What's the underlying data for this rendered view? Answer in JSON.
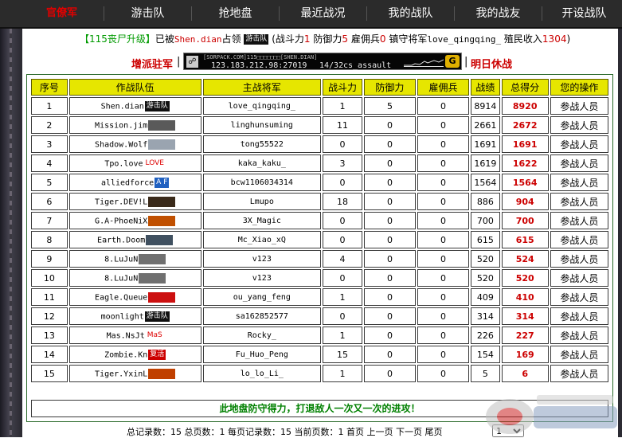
{
  "nav": {
    "items": [
      {
        "label": "官僚军",
        "active": true
      },
      {
        "label": "游击队"
      },
      {
        "label": "抢地盘"
      },
      {
        "label": "最近战况"
      },
      {
        "label": "我的战队"
      },
      {
        "label": "我的战友"
      },
      {
        "label": "开设战队"
      }
    ]
  },
  "info": {
    "level_tag": "【115丧尸升级】",
    "was_by": "已被",
    "occupier": "Shen.dian",
    "occupied": "占领",
    "team_badge": "游击队",
    "combat_label": "(战斗力",
    "combat_value": "1",
    "defense_label": "防御力",
    "defense_value": "5",
    "merc_label": "雇佣兵",
    "merc_value": "0",
    "general_label": "镇守将军",
    "general_value": "love_qingqing_",
    "income_label": "殖民收入",
    "income_value": "1304",
    "close": ")"
  },
  "station": {
    "deploy": "增派驻军",
    "sep": "|",
    "tomorrow": "明日休战",
    "banner_line1": "[SORPACK.COM]115□□□□□□□[SHEN.DIAN]",
    "banner_ip": "123.183.212.98:27019",
    "banner_players": "14/32",
    "banner_map": "cs_assault",
    "banner_logo": "G"
  },
  "table": {
    "headers": [
      "序号",
      "作战队伍",
      "主战将军",
      "战斗力",
      "防御力",
      "雇佣兵",
      "战绩",
      "总得分",
      "您的操作"
    ],
    "rows": [
      {
        "no": "1",
        "team": "Shen.dian",
        "icon": "游击队",
        "icon_color": "#111111",
        "general": "love_qingqing_",
        "combat": "1",
        "defense": "5",
        "merc": "0",
        "record": "8914",
        "score": "8920",
        "action": "参战人员"
      },
      {
        "no": "2",
        "team": "Mission.jim",
        "icon": "",
        "icon_color": "#5a5a5a",
        "general": "linghunsuming",
        "combat": "11",
        "defense": "0",
        "merc": "0",
        "record": "2661",
        "score": "2672",
        "action": "参战人员"
      },
      {
        "no": "3",
        "team": "Shadow.Wolf",
        "icon": "",
        "icon_color": "#9aa4b0",
        "general": "tong55522",
        "combat": "0",
        "defense": "0",
        "merc": "0",
        "record": "1691",
        "score": "1691",
        "action": "参战人员"
      },
      {
        "no": "4",
        "team": "Tpo.love",
        "icon": "LOVE",
        "icon_color": "#ffffff",
        "general": "kaka_kaku_",
        "combat": "3",
        "defense": "0",
        "merc": "0",
        "record": "1619",
        "score": "1622",
        "action": "参战人员"
      },
      {
        "no": "5",
        "team": "alliedforce",
        "icon": "A F",
        "icon_color": "#2060c0",
        "general": "bcw1106034314",
        "combat": "0",
        "defense": "0",
        "merc": "0",
        "record": "1564",
        "score": "1564",
        "action": "参战人员"
      },
      {
        "no": "6",
        "team": "Tiger.DEV!L",
        "icon": "",
        "icon_color": "#3a2a1a",
        "general": "Lmupo",
        "combat": "18",
        "defense": "0",
        "merc": "0",
        "record": "886",
        "score": "904",
        "action": "参战人员"
      },
      {
        "no": "7",
        "team": "G.A-PhoeNiX",
        "icon": "",
        "icon_color": "#c05000",
        "general": "3X_Magic",
        "combat": "0",
        "defense": "0",
        "merc": "0",
        "record": "700",
        "score": "700",
        "action": "参战人员"
      },
      {
        "no": "8",
        "team": "Earth.Doom",
        "icon": "",
        "icon_color": "#405060",
        "general": "Mc_Xiao_xQ",
        "combat": "0",
        "defense": "0",
        "merc": "0",
        "record": "615",
        "score": "615",
        "action": "参战人员"
      },
      {
        "no": "9",
        "team": "8.LuJuN",
        "icon": "",
        "icon_color": "#707070",
        "general": "v123",
        "combat": "4",
        "defense": "0",
        "merc": "0",
        "record": "520",
        "score": "524",
        "action": "参战人员"
      },
      {
        "no": "10",
        "team": "8.LuJuN",
        "icon": "",
        "icon_color": "#707070",
        "general": "v123",
        "combat": "0",
        "defense": "0",
        "merc": "0",
        "record": "520",
        "score": "520",
        "action": "参战人员"
      },
      {
        "no": "11",
        "team": "Eagle.Queue",
        "icon": "",
        "icon_color": "#cc1010",
        "general": "ou_yang_feng",
        "combat": "1",
        "defense": "0",
        "merc": "0",
        "record": "409",
        "score": "410",
        "action": "参战人员"
      },
      {
        "no": "12",
        "team": "moonlight",
        "icon": "游击队",
        "icon_color": "#111111",
        "general": "sa162852577",
        "combat": "0",
        "defense": "0",
        "merc": "0",
        "record": "314",
        "score": "314",
        "action": "参战人员"
      },
      {
        "no": "13",
        "team": "Mas.NsJt",
        "icon": "MaS",
        "icon_color": "#ffffff",
        "general": "Rocky_",
        "combat": "1",
        "defense": "0",
        "merc": "0",
        "record": "226",
        "score": "227",
        "action": "参战人员"
      },
      {
        "no": "14",
        "team": "Zombie.Kn",
        "icon": "复活",
        "icon_color": "#cc0000",
        "general": "Fu_Huo_Peng",
        "combat": "15",
        "defense": "0",
        "merc": "0",
        "record": "154",
        "score": "169",
        "action": "参战人员"
      },
      {
        "no": "15",
        "team": "Tiger.YxinL",
        "icon": "",
        "icon_color": "#c04000",
        "general": "lo_lo_Li_",
        "combat": "1",
        "defense": "0",
        "merc": "0",
        "record": "5",
        "score": "6",
        "action": "参战人员"
      }
    ],
    "slogan": "此地盘防守得力，打退敌人一次又一次的进攻！"
  },
  "pagination": {
    "text": "总记录数：15  总页数：1  每页记录数：15  当前页数：1",
    "first": "首页",
    "prev": "上一页",
    "next": "下一页",
    "last": "尾页",
    "select_value": "1"
  },
  "colors": {
    "nav_bg": "#2b2b2b",
    "header_yellow": "#e6e600",
    "score_red": "#cc0000",
    "slogan_green": "#008000"
  }
}
